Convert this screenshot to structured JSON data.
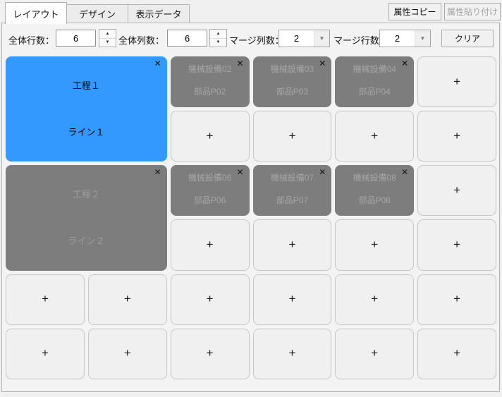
{
  "tabs": [
    {
      "label": "レイアウト",
      "active": true
    },
    {
      "label": "デザイン",
      "active": false
    },
    {
      "label": "表示データ",
      "active": false
    }
  ],
  "header": {
    "copy_button": "属性コピー",
    "paste_button": "属性貼り付け",
    "paste_disabled": true
  },
  "toolbar": {
    "total_rows_label": "全体行数：",
    "total_rows_value": "6",
    "total_cols_label": "全体列数：",
    "total_cols_value": "6",
    "merge_cols_label": "マージ列数：",
    "merge_cols_value": "2",
    "merge_rows_label": "マージ行数：",
    "merge_rows_value": "2",
    "clear_button": "クリア"
  },
  "icons": {
    "close": "✕",
    "spin_up": "▲",
    "spin_down": "▼",
    "dropdown_arrow": "▼",
    "plus": "+"
  },
  "colors": {
    "selected_cell": "#3399ff",
    "inactive_cell": "#7d7d7d",
    "empty_cell_bg": "#f0f0f0"
  },
  "grid": {
    "total_rows": 6,
    "total_cols": 6,
    "merge_span": "2x2",
    "merged_cells": [
      {
        "title": "工程１",
        "subtitle": "ライン１",
        "state": "selected"
      },
      {
        "title": "工程２",
        "subtitle": "ライン２",
        "state": "inactive"
      }
    ],
    "machine_cells": [
      {
        "title": "機械設備02",
        "subtitle": "部品P02"
      },
      {
        "title": "機械設備03",
        "subtitle": "部品P03"
      },
      {
        "title": "機械設備04",
        "subtitle": "部品P04"
      },
      {
        "title": "機械設備06",
        "subtitle": "部品P06"
      },
      {
        "title": "機械設備07",
        "subtitle": "部品P07"
      },
      {
        "title": "機械設備08",
        "subtitle": "部品P08"
      }
    ]
  }
}
